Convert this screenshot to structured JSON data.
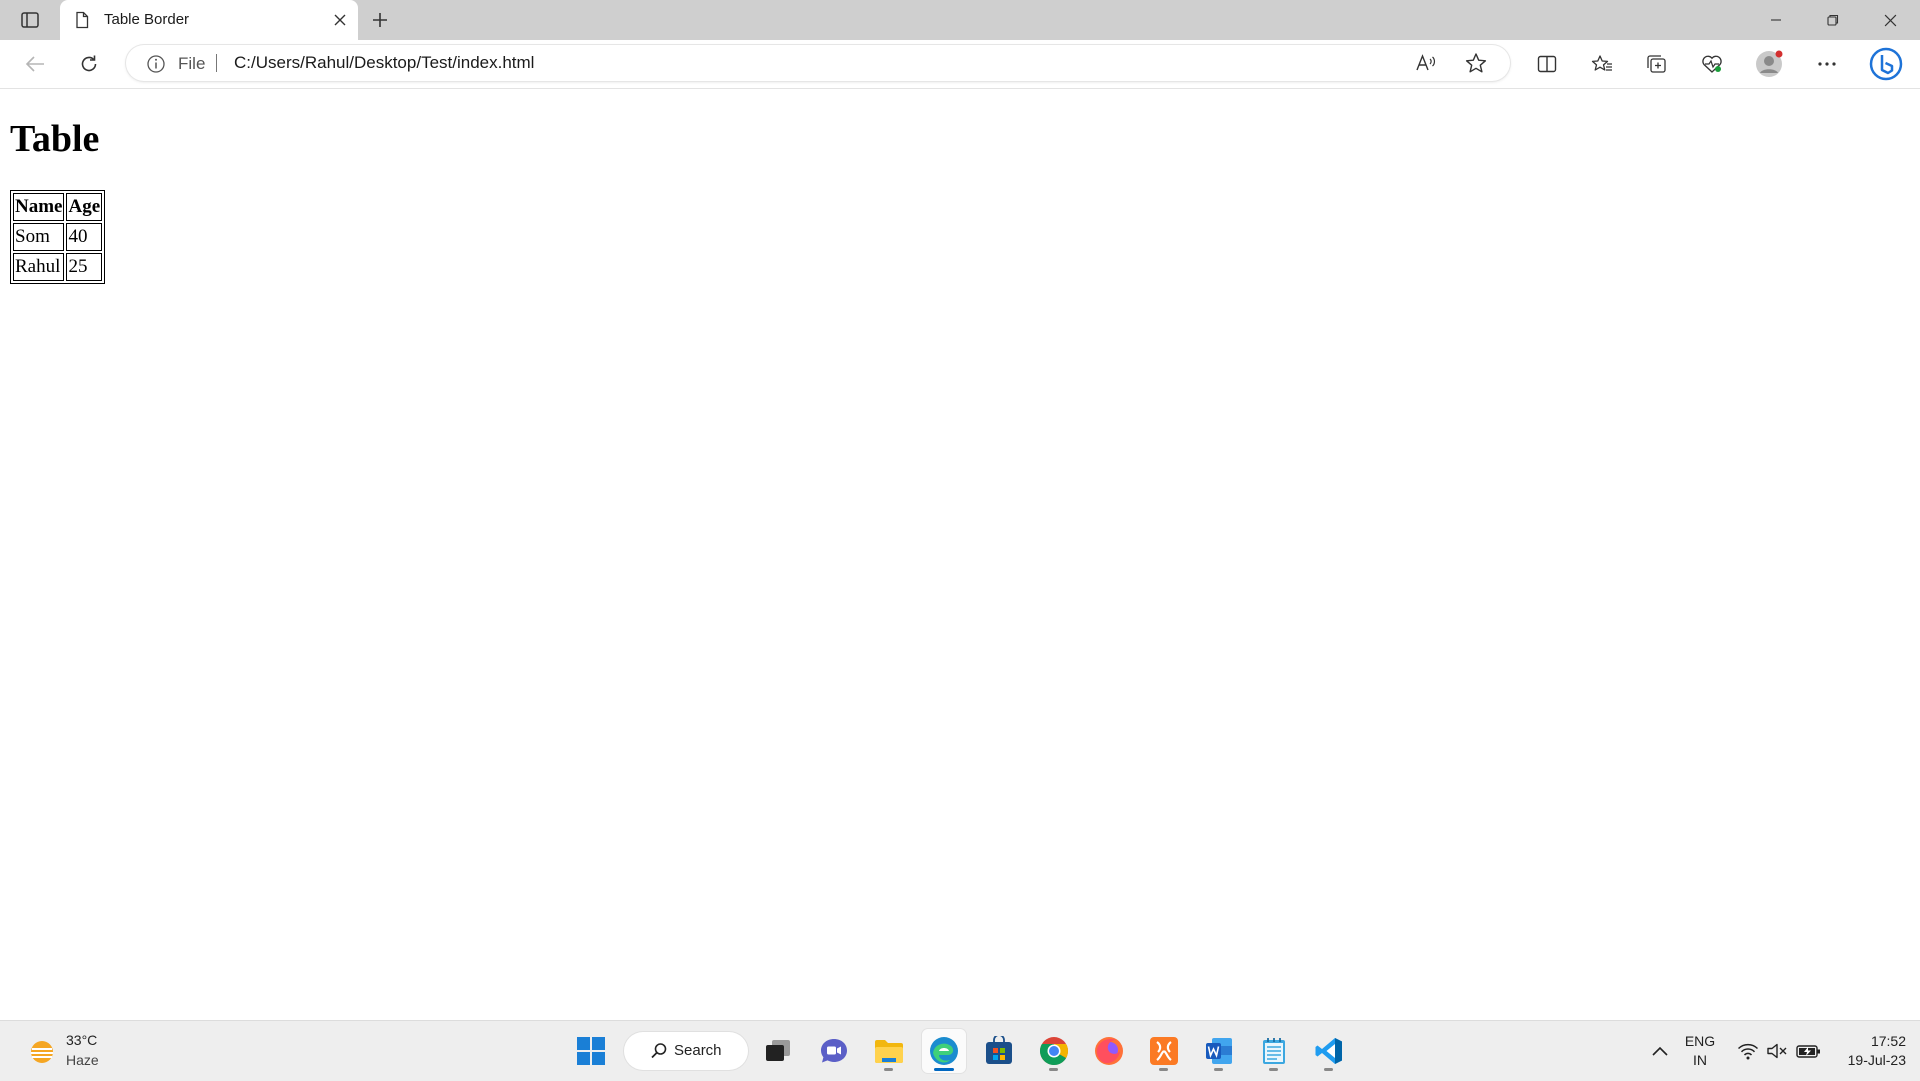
{
  "browser": {
    "tab_title": "Table Border",
    "address": {
      "scheme_label": "File",
      "url": "C:/Users/Rahul/Desktop/Test/index.html"
    }
  },
  "page": {
    "heading": "Table",
    "table": {
      "headers": [
        "Name",
        "Age"
      ],
      "rows": [
        [
          "Som",
          "40"
        ],
        [
          "Rahul",
          "25"
        ]
      ]
    }
  },
  "taskbar": {
    "weather": {
      "temp": "33°C",
      "condition": "Haze"
    },
    "search_label": "Search",
    "apps": [
      "start",
      "search",
      "task-view",
      "teams",
      "file-explorer",
      "edge",
      "store",
      "chrome",
      "firefox",
      "xampp",
      "word",
      "notepad",
      "vscode"
    ],
    "language": {
      "line1": "ENG",
      "line2": "IN"
    },
    "clock": {
      "time": "17:52",
      "date": "19-Jul-23"
    }
  },
  "colors": {
    "titlebar": "#cfcfcf",
    "accent": "#0067c0",
    "taskbar": "#eeeeee"
  }
}
